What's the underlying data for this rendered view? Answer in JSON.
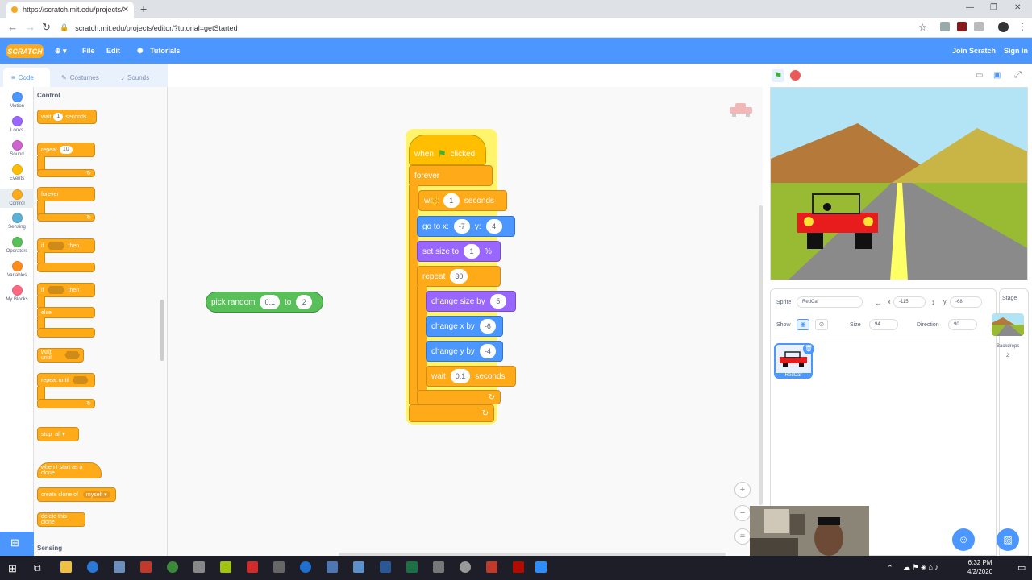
{
  "browser": {
    "tab_title": "https://scratch.mit.edu/projects/",
    "url": "scratch.mit.edu/projects/editor/?tutorial=getStarted"
  },
  "menubar": {
    "logo": "SCRATCH",
    "file": "File",
    "edit": "Edit",
    "tutorials": "Tutorials",
    "join": "Join Scratch",
    "signin": "Sign in"
  },
  "editor_tabs": {
    "code": "Code",
    "costumes": "Costumes",
    "sounds": "Sounds"
  },
  "categories": [
    {
      "label": "Motion",
      "color": "#4c97ff"
    },
    {
      "label": "Looks",
      "color": "#9966ff"
    },
    {
      "label": "Sound",
      "color": "#cf63cf"
    },
    {
      "label": "Events",
      "color": "#ffbf00"
    },
    {
      "label": "Control",
      "color": "#ffab19"
    },
    {
      "label": "Sensing",
      "color": "#5cb1d6"
    },
    {
      "label": "Operators",
      "color": "#59c059"
    },
    {
      "label": "Variables",
      "color": "#ff8c1a"
    },
    {
      "label": "My Blocks",
      "color": "#ff6680"
    }
  ],
  "palette": {
    "heading": "Control",
    "wait": "wait",
    "wait_val": "1",
    "seconds": "seconds",
    "repeat": "repeat",
    "repeat_val": "10",
    "forever": "forever",
    "if_then_if": "if",
    "then": "then",
    "else": "else",
    "wait_until": "wait until",
    "repeat_until": "repeat until",
    "stop": "stop",
    "stop_val": "all",
    "clone_start": "when I start as a clone",
    "create_clone": "create clone of",
    "clone_val": "myself",
    "delete_clone": "delete this clone",
    "sensing": "Sensing"
  },
  "script": {
    "when": "when",
    "clicked": "clicked",
    "forever": "forever",
    "wait": "wait",
    "wait_val": "1",
    "seconds": "seconds",
    "goto": "go to x:",
    "goto_x": "-7",
    "goto_y_label": "y:",
    "goto_y": "4",
    "setsize": "set size to",
    "setsize_val": "1",
    "percent": "%",
    "repeat": "repeat",
    "repeat_val": "30",
    "changesize": "change size by",
    "changesize_val": "5",
    "changex": "change x by",
    "changex_val": "-6",
    "changey": "change y by",
    "changey_val": "-4",
    "wait2": "wait",
    "wait2_val": "0.1",
    "seconds2": "seconds"
  },
  "loose_block": {
    "label": "pick random",
    "from": "0.1",
    "to_label": "to",
    "to": "2"
  },
  "sprite": {
    "label": "Sprite",
    "name": "RedCar",
    "x_label": "x",
    "x": "-115",
    "y_label": "y",
    "y": "-68",
    "show": "Show",
    "size_label": "Size",
    "size": "94",
    "direction_label": "Direction",
    "direction": "90",
    "thumb_name": "RedCar"
  },
  "stagepane": {
    "label": "Stage",
    "backdrops": "Backdrops",
    "backdrops_count": "2"
  },
  "clock": {
    "time": "6:32 PM",
    "date": "4/2/2020"
  }
}
